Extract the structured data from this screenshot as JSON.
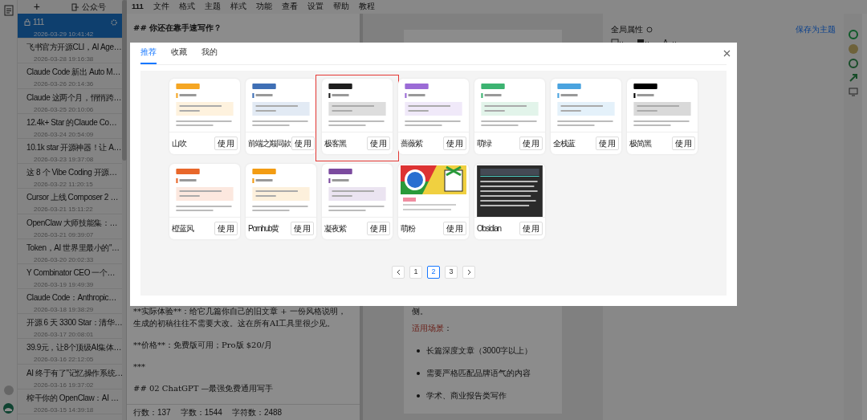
{
  "menu": {
    "title": "111",
    "items": [
      "文件",
      "格式",
      "主题",
      "样式",
      "功能",
      "查看",
      "设置",
      "帮助",
      "教程"
    ]
  },
  "sidebar": {
    "add_label": "+",
    "account_label": "公众号",
    "articles": [
      {
        "title": "111",
        "date": "2026-03-29 10:41:42",
        "selected": true
      },
      {
        "title": "飞书官方开源CLI，AI Age…",
        "date": "2026-03-28 19:16:38",
        "selected": false
      },
      {
        "title": "Claude Code 新出 Auto M…",
        "date": "2026-03-26 20:14:36",
        "selected": false
      },
      {
        "title": "Claude 这两个月，悄悄跨…",
        "date": "2026-03-25 20:10:06",
        "selected": false
      },
      {
        "title": "12.4k+ Star 的Claude Co…",
        "date": "2026-03-24 20:54:09",
        "selected": false
      },
      {
        "title": "10.1k star 开源神器！让 A…",
        "date": "2026-03-23 19:37:08",
        "selected": false
      },
      {
        "title": "这 8 个 Vibe Coding 开源…",
        "date": "2026-03-22 11:20:15",
        "selected": false
      },
      {
        "title": "Cursor 上线 Composer 2 …",
        "date": "2026-03-21 15:11:22",
        "selected": false
      },
      {
        "title": "OpenClaw 大师技能集：…",
        "date": "2026-03-21 09:39:07",
        "selected": false
      },
      {
        "title": "Token，AI 世界里最小的\"…",
        "date": "2026-03-20 20:02:33",
        "selected": false
      },
      {
        "title": "Y Combinator CEO 一个…",
        "date": "2026-03-19 19:49:39",
        "selected": false
      },
      {
        "title": "Claude Code：Anthropic…",
        "date": "2026-03-18 19:38:29",
        "selected": false
      },
      {
        "title": "开源 6 天 3300 Star：清华…",
        "date": "2026-03-17 20:08:01",
        "selected": false
      },
      {
        "title": "39.9元，让8个顶级AI集体…",
        "date": "2026-03-16 22:12:05",
        "selected": false
      },
      {
        "title": "AI 终于有了\"记忆操作系统…",
        "date": "2026-03-16 19:37:02",
        "selected": false
      },
      {
        "title": "榨干你的 OpenClaw：AI …",
        "date": "2026-03-15 14:39:18",
        "selected": false
      }
    ]
  },
  "editor": {
    "heading": "## 你还在靠手速写作？",
    "lines": [
      "**实际体验**：给它几篇你自己的旧文章 + 一份风格说明，生成的初稿往往不需要大改。这在所有AI工具里很少见。",
      "**价格**：免费版可用；Pro版 $20/月",
      "***",
      "## 02 ChatGPT —最强免费通用写手"
    ],
    "status": [
      "行数：137",
      "字数：1544",
      "字符数：2488"
    ]
  },
  "preview": {
    "fragment": "侧。",
    "label": "适用场景",
    "label_suffix": "：",
    "bullets": [
      "长篇深度文章（3000字以上）",
      "需要严格匹配品牌语气的内容",
      "学术、商业报告类写作"
    ]
  },
  "properties": {
    "title": "全局属性",
    "save_link": "保存为主题"
  },
  "dialog": {
    "tabs": [
      {
        "label": "推荐",
        "selected": true
      },
      {
        "label": "收藏",
        "selected": false
      },
      {
        "label": "我的",
        "selected": false
      }
    ],
    "themes": [
      {
        "name": "山吹",
        "use_label": "使用",
        "kind": "light",
        "color": "#f5a623",
        "selected": false
      },
      {
        "name": "前端之巅同款",
        "use_label": "使用",
        "kind": "light",
        "color": "#3f6fb5",
        "selected": false
      },
      {
        "name": "极客黑",
        "use_label": "使用",
        "kind": "light",
        "color": "#1e1e1e",
        "selected": true
      },
      {
        "name": "蔷薇紫",
        "use_label": "使用",
        "kind": "light",
        "color": "#9b6bd6",
        "selected": false
      },
      {
        "name": "萌绿",
        "use_label": "使用",
        "kind": "light",
        "color": "#3cb371",
        "selected": false
      },
      {
        "name": "全栈蓝",
        "use_label": "使用",
        "kind": "light",
        "color": "#4aa3df",
        "selected": false
      },
      {
        "name": "极简黑",
        "use_label": "使用",
        "kind": "light",
        "color": "#000000",
        "selected": false
      },
      {
        "name": "橙蓝风",
        "use_label": "使用",
        "kind": "light",
        "color": "#e8672a",
        "selected": false
      },
      {
        "name": "Pornhub黄",
        "use_label": "使用",
        "kind": "light",
        "color": "#f39c12",
        "selected": false
      },
      {
        "name": "凝夜紫",
        "use_label": "使用",
        "kind": "light",
        "color": "#7b4a9e",
        "selected": false
      },
      {
        "name": "萌粉",
        "use_label": "使用",
        "kind": "picture",
        "color": "#f08ca0",
        "selected": false
      },
      {
        "name": "Obsidian",
        "use_label": "使用",
        "kind": "dark",
        "color": "#2b2b2b",
        "selected": false
      }
    ],
    "pagination": {
      "pages": [
        {
          "label": "1",
          "selected": false
        },
        {
          "label": "2",
          "selected": true
        },
        {
          "label": "3",
          "selected": false
        }
      ]
    }
  }
}
